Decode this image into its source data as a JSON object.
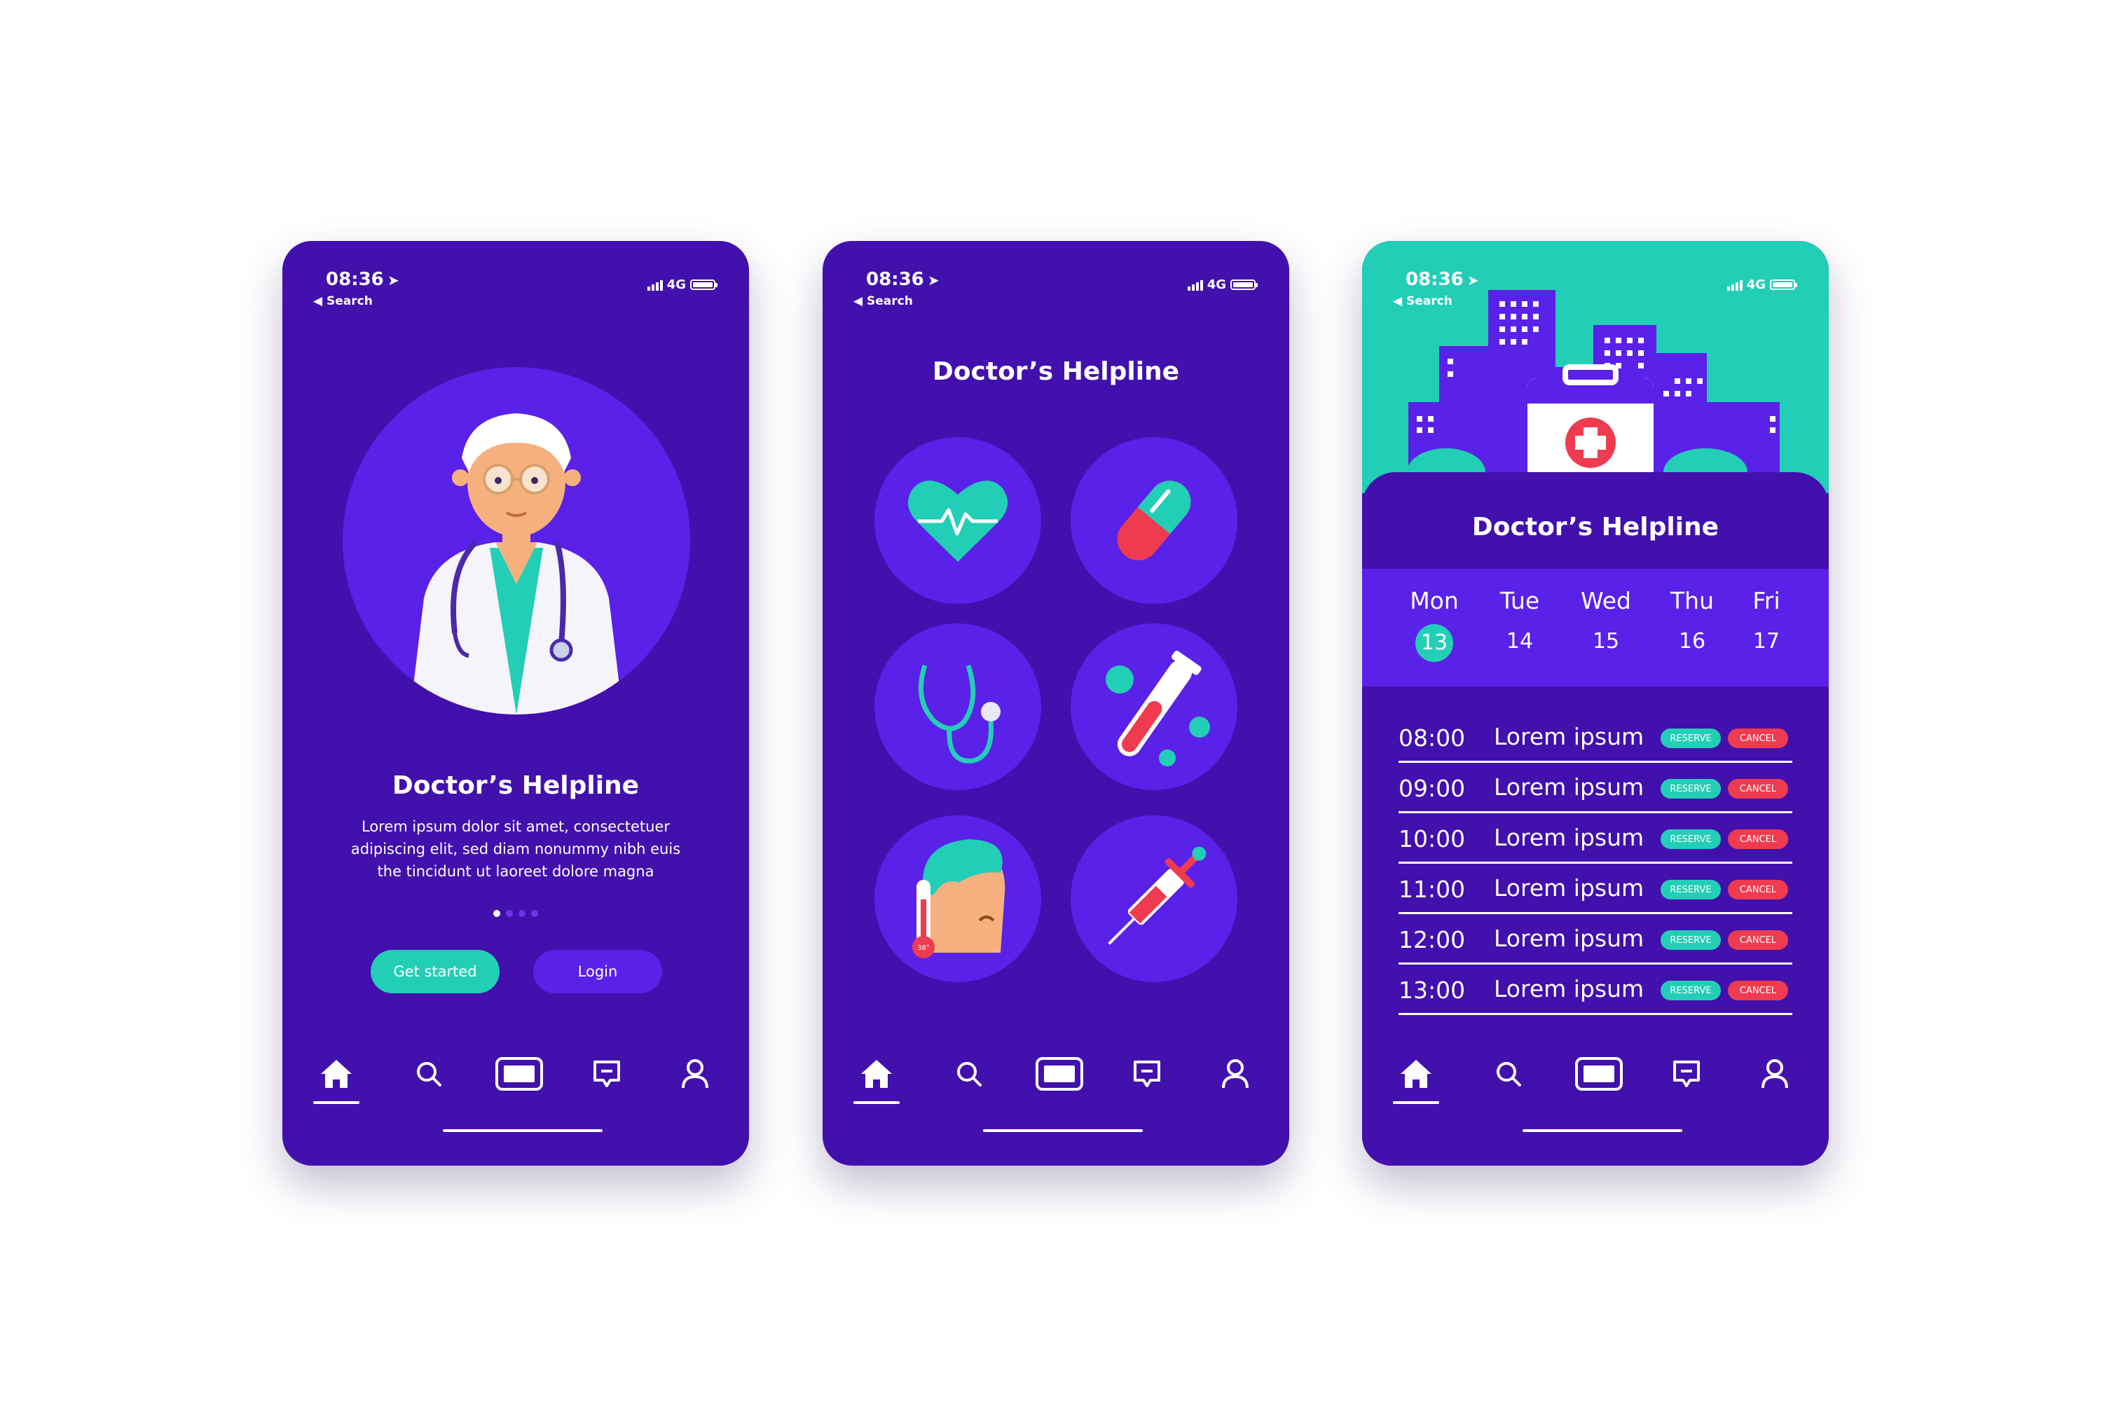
{
  "status": {
    "time": "08:36",
    "back_label": "Search",
    "network": "4G"
  },
  "app_title": "Doctor’s Helpline",
  "onboarding": {
    "description_lines": [
      "Lorem ipsum dolor sit amet, consectetuer",
      "adipiscing elit, sed diam nonummy nibh euis",
      "the tincidunt ut laoreet dolore magna"
    ],
    "page_count": 4,
    "active_page": 1,
    "get_started_label": "Get started",
    "login_label": "Login"
  },
  "categories": {
    "icons": [
      "heart-icon",
      "pill-icon",
      "stethoscope-icon",
      "test-tube-icon",
      "thermometer-patient-icon",
      "syringe-icon"
    ]
  },
  "schedule": {
    "days": [
      {
        "name": "Mon",
        "date": "13",
        "selected": true
      },
      {
        "name": "Tue",
        "date": "14",
        "selected": false
      },
      {
        "name": "Wed",
        "date": "15",
        "selected": false
      },
      {
        "name": "Thu",
        "date": "16",
        "selected": false
      },
      {
        "name": "Fri",
        "date": "17",
        "selected": false
      }
    ],
    "slots": [
      {
        "time": "08:00",
        "label": "Lorem ipsum"
      },
      {
        "time": "09:00",
        "label": "Lorem ipsum"
      },
      {
        "time": "10:00",
        "label": "Lorem ipsum"
      },
      {
        "time": "11:00",
        "label": "Lorem ipsum"
      },
      {
        "time": "12:00",
        "label": "Lorem ipsum"
      },
      {
        "time": "13:00",
        "label": "Lorem ipsum"
      }
    ],
    "reserve_label": "RESERVE",
    "cancel_label": "CANCEL"
  },
  "thermometer_label": "38°",
  "nav": {
    "items": [
      "home-icon",
      "search-icon",
      "card-icon",
      "chat-icon",
      "profile-icon"
    ],
    "active": "home-icon"
  },
  "colors": {
    "background": "#4210ac",
    "accent": "#5a21e8",
    "teal": "#23ceb6",
    "red": "#ef3b50",
    "white": "#ffffff"
  }
}
